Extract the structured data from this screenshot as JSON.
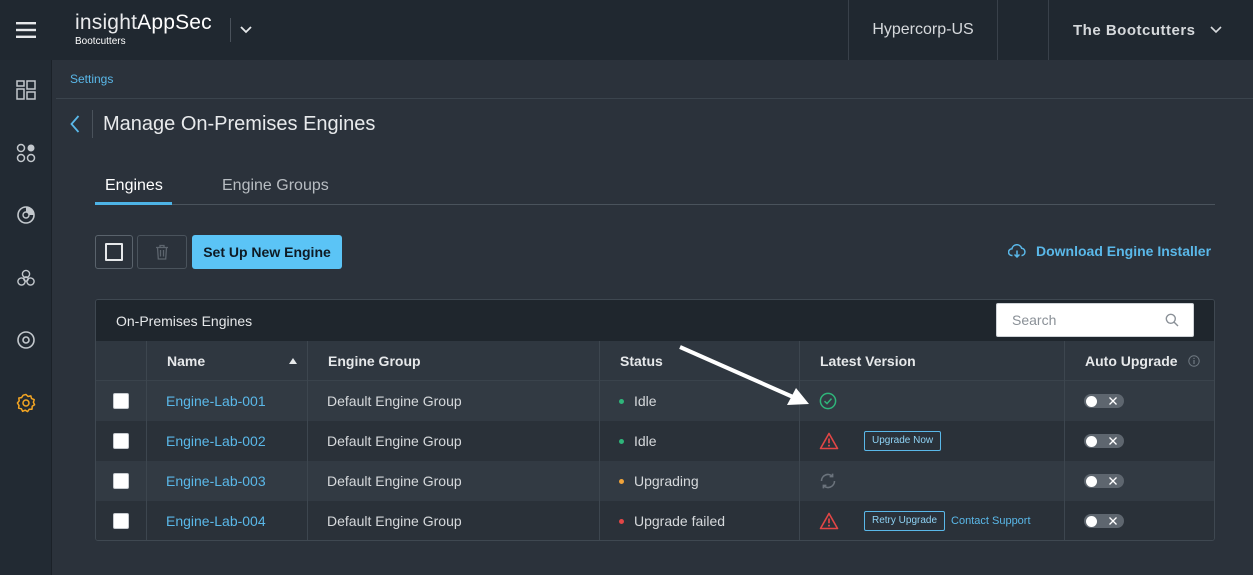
{
  "header": {
    "brand_light": "insight",
    "brand_bold": "AppSec",
    "brand_sub": "Bootcutters",
    "org": "Hypercorp-US",
    "user": "The Bootcutters"
  },
  "breadcrumb": "Settings",
  "page_title": "Manage On-Premises Engines",
  "tabs": [
    {
      "label": "Engines",
      "active": true
    },
    {
      "label": "Engine Groups",
      "active": false
    }
  ],
  "toolbar": {
    "setup_label": "Set Up New Engine",
    "download_label": "Download Engine Installer"
  },
  "table": {
    "title": "On-Premises Engines",
    "search_placeholder": "Search",
    "columns": [
      "Name",
      "Engine Group",
      "Status",
      "Latest Version",
      "Auto Upgrade"
    ],
    "rows": [
      {
        "name": "Engine-Lab-001",
        "group": "Default Engine Group",
        "status": "Idle",
        "status_color": "#2fb57a",
        "version_state": "up-to-date",
        "action": "",
        "extra_link": ""
      },
      {
        "name": "Engine-Lab-002",
        "group": "Default Engine Group",
        "status": "Idle",
        "status_color": "#2fb57a",
        "version_state": "warning",
        "action": "Upgrade Now",
        "extra_link": ""
      },
      {
        "name": "Engine-Lab-003",
        "group": "Default Engine Group",
        "status": "Upgrading",
        "status_color": "#f0a33a",
        "version_state": "in-progress",
        "action": "",
        "extra_link": ""
      },
      {
        "name": "Engine-Lab-004",
        "group": "Default Engine Group",
        "status": "Upgrade failed",
        "status_color": "#e24646",
        "version_state": "warning",
        "action": "Retry Upgrade",
        "extra_link": "Contact Support"
      }
    ]
  },
  "colors": {
    "accent": "#5bc4f6",
    "link": "#5ab8e9",
    "settings_active": "#f5a623",
    "ok": "#2fb57a",
    "warn": "#e24646"
  }
}
